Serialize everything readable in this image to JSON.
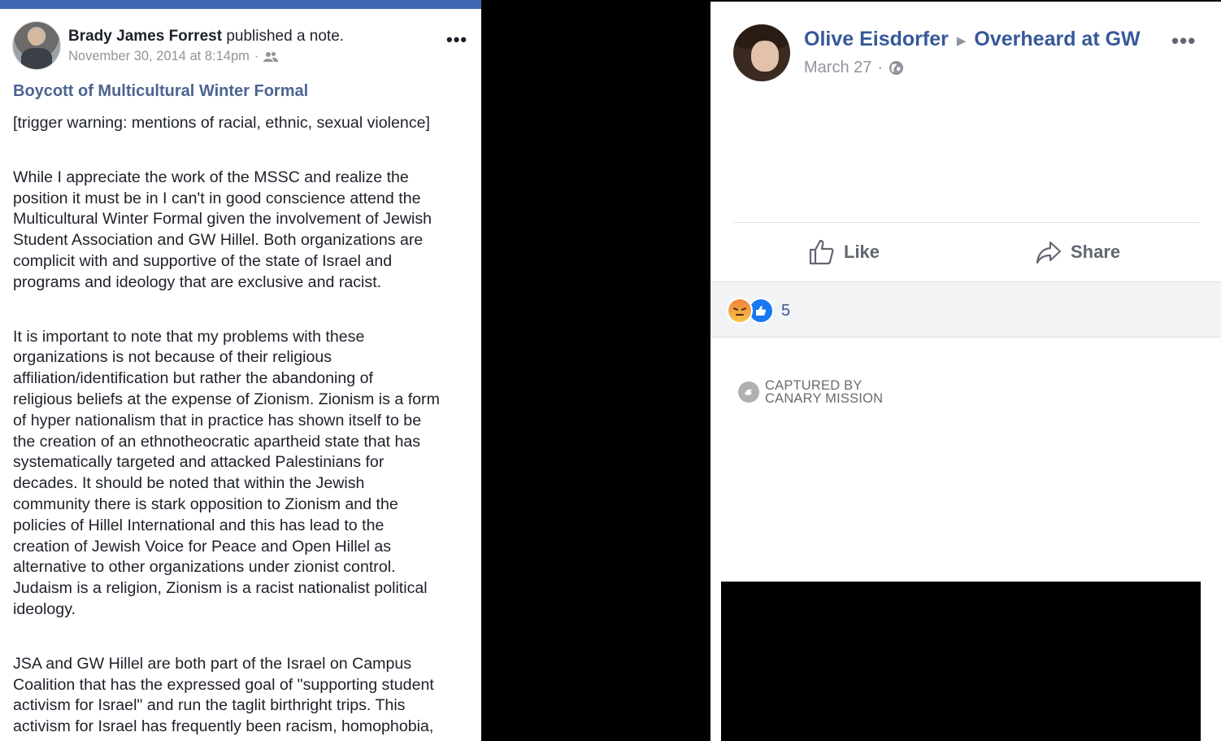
{
  "left_note": {
    "author": "Brady James Forrest",
    "action": "published a note.",
    "timestamp": "November 30, 2014 at 8:14pm",
    "separator": "·",
    "privacy_icon": "friends-icon",
    "more_label": "•••",
    "title": "Boycott of Multicultural Winter Formal",
    "paragraphs": [
      [
        "[trigger warning: mentions of racial, ethnic, sexual violence]"
      ],
      [
        "While I appreciate the work of the MSSC and realize the",
        "position it must be in I can't in good conscience attend the",
        "Multicultural Winter Formal given the involvement of Jewish",
        "Student Association and GW Hillel.  Both organizations are",
        "complicit with and supportive of the state of Israel and",
        "programs and ideology that are exclusive and racist."
      ],
      [
        "It is important to note that my problems with these",
        "organizations is not because of their religious",
        "affiliation/identification but rather the abandoning of",
        "religious beliefs at the expense of Zionism.  Zionism is a form",
        "of hyper nationalism that in practice has shown itself to be",
        "the creation of an ethnotheocratic apartheid state that has",
        "systematically targeted and attacked Palestinians for",
        "decades.  It should be noted that within the Jewish",
        "community there is stark opposition to Zionism and the",
        "policies of Hillel International and this has lead to the",
        "creation of Jewish Voice for Peace and Open Hillel as",
        "alternative to other organizations under zionist control.",
        " Judaism is a religion, Zionism is a racist nationalist political",
        "ideology."
      ],
      [
        "JSA and GW Hillel are both part of the Israel on Campus",
        "Coalition that has the expressed goal of \"supporting student",
        "activism for Israel\" and run the taglit birthright trips.  This",
        "activism for Israel has frequently been racism, homophobia,"
      ]
    ]
  },
  "right_post": {
    "author": "Olive Eisdorfer",
    "group": "Overheard at GW",
    "arrow_icon": "triangle-right-icon",
    "date": "March 27",
    "separator": "·",
    "privacy_icon": "globe-icon",
    "more_label": "•••",
    "like_label": "Like",
    "share_label": "Share",
    "reactions": [
      "angry-reaction-icon",
      "like-reaction-icon"
    ],
    "reaction_count": "5",
    "captured_line1": "CAPTURED BY",
    "captured_line2": "CANARY MISSION"
  },
  "colors": {
    "link_blue": "#365899",
    "title_blue": "#4b6491",
    "meta_gray": "#90949c",
    "top_bar": "#4267b2",
    "reaction_bar_bg": "#f2f3f5"
  }
}
